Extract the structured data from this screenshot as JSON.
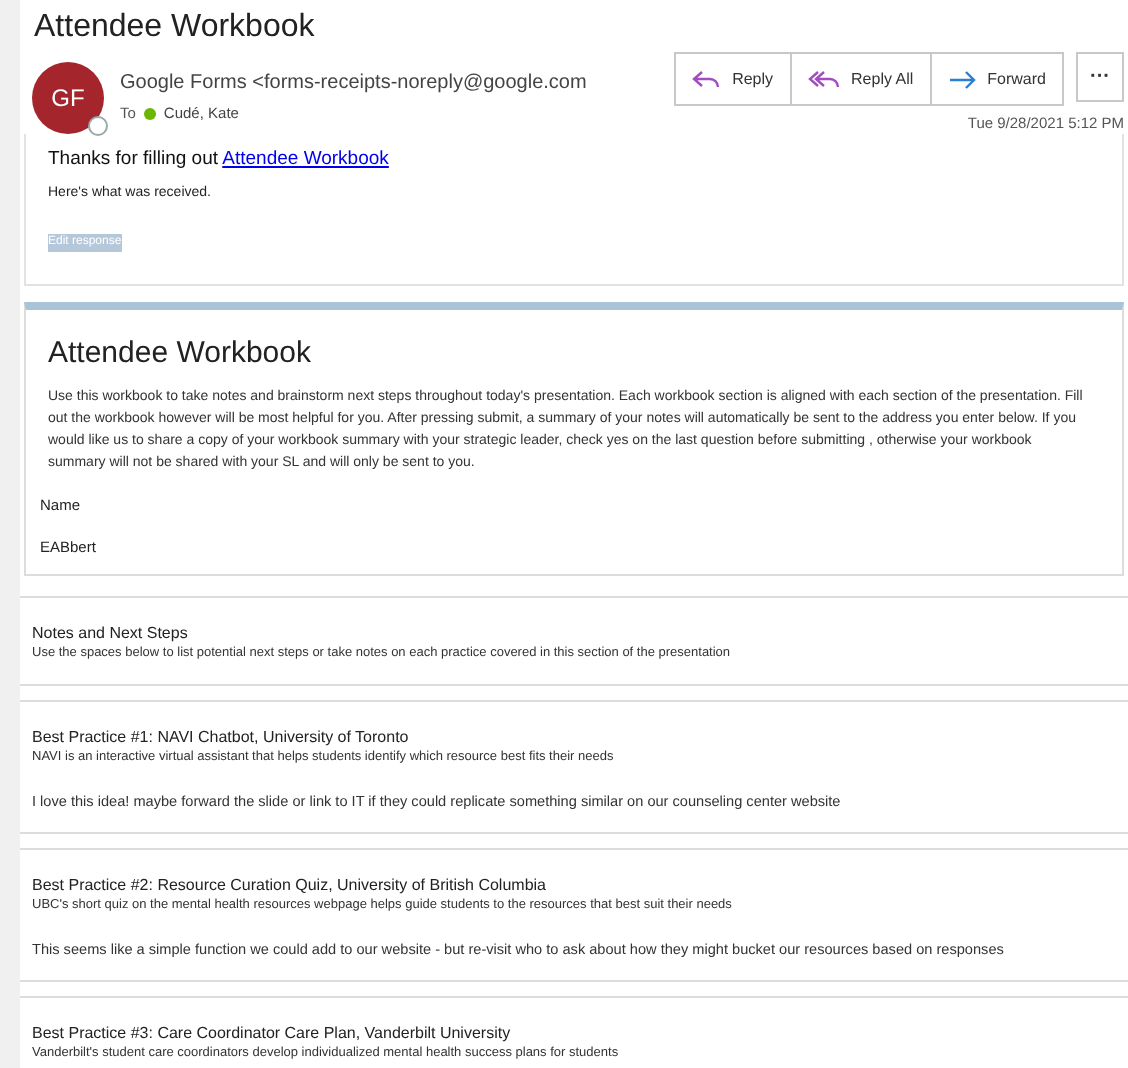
{
  "email": {
    "subject": "Attendee Workbook",
    "sender": {
      "initials": "GF",
      "name": "Google Forms <forms-receipts-noreply@google.com"
    },
    "to_label": "To",
    "recipient": "Cudé, Kate",
    "date": "Tue 9/28/2021 5:12 PM",
    "actions": [
      {
        "kind": "reply",
        "label": "Reply"
      },
      {
        "kind": "reply_all",
        "label": "Reply All"
      },
      {
        "kind": "forward",
        "label": "Forward"
      }
    ],
    "more": "···"
  },
  "body": {
    "thanks": "Thanks for filling out",
    "link": "Attendee Workbook",
    "received": "Here's what was received.",
    "edit": "Edit response"
  },
  "form": {
    "title": "Attendee Workbook",
    "description": "Use this workbook to take notes and brainstorm next steps throughout today's presentation. Each workbook section is aligned with each section of the presentation. Fill out the workbook however will be most helpful for you. After pressing submit, a summary of your notes will automatically be sent to the address you enter below. If you would like us to share a copy of your workbook summary with your strategic leader, check yes on the last question before submitting , otherwise your workbook summary will not be shared with your SL and will only be sent to you.",
    "fields": [
      {
        "label": "Name",
        "value": "EABbert"
      }
    ]
  },
  "sections": [
    {
      "title": "Notes and Next Steps",
      "description": "Use the spaces below to list potential next steps or take notes on each practice covered in this section of the presentation"
    },
    {
      "title": "Best Practice #1: NAVI Chatbot, University of Toronto",
      "description": "NAVI is an interactive virtual assistant that helps students identify which resource best fits their needs",
      "answer": "I love this idea! maybe forward the slide or link to IT if they could replicate something similar on our counseling center website"
    },
    {
      "title": "Best Practice #2: Resource Curation Quiz, University of British Columbia",
      "description": "UBC's short quiz on the mental health resources webpage helps guide students to the resources that best suit their needs",
      "answer": "This seems like a simple function we could add to our website - but re-visit who to ask about how they might bucket our resources based on responses"
    },
    {
      "title": "Best Practice #3: Care Coordinator Care Plan, Vanderbilt University",
      "description": "Vanderbilt's student care coordinators develop individualized mental health success plans for students"
    }
  ]
}
